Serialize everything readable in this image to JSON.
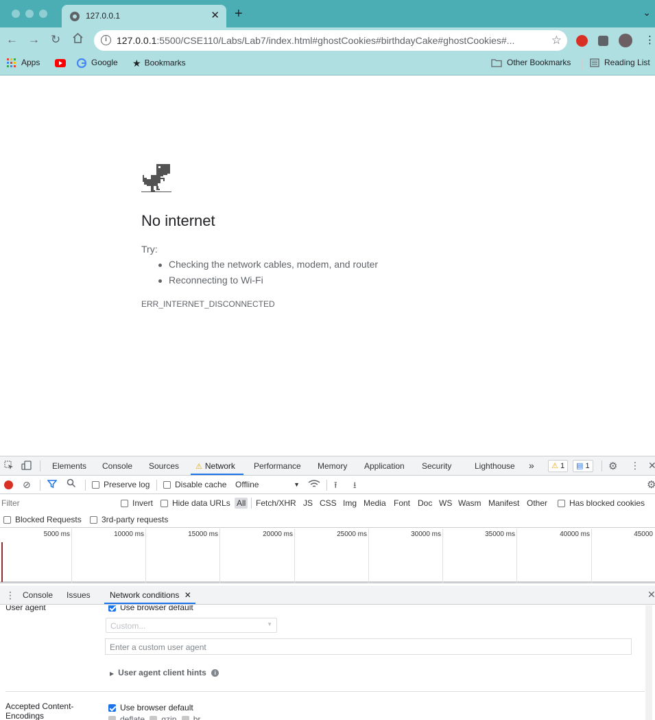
{
  "browser": {
    "tab_title": "127.0.0.1",
    "url_host": "127.0.0.1",
    "url_rest": ":5500/CSE110/Labs/Lab7/index.html#ghostCookies#birthdayCake#ghostCookies#...",
    "bookmarks": [
      {
        "label": "Apps",
        "icon": "apps-grid-icon"
      },
      {
        "label": "",
        "icon": "youtube-icon"
      },
      {
        "label": "Google",
        "icon": "google-icon"
      },
      {
        "label": "Bookmarks",
        "icon": "star-icon"
      }
    ],
    "other_bookmarks": "Other Bookmarks",
    "reading_list": "Reading List"
  },
  "error_page": {
    "title": "No internet",
    "try_label": "Try:",
    "tips": [
      "Checking the network cables, modem, and router",
      "Reconnecting to Wi-Fi"
    ],
    "error_code": "ERR_INTERNET_DISCONNECTED"
  },
  "devtools": {
    "tabs": [
      "Elements",
      "Console",
      "Sources",
      "Network",
      "Performance",
      "Memory",
      "Application",
      "Security",
      "Lighthouse"
    ],
    "active_tab": "Network",
    "more": "»",
    "warnings_count": "1",
    "messages_count": "1",
    "toolbar": {
      "preserve_log": "Preserve log",
      "disable_cache": "Disable cache",
      "throttle": "Offline"
    },
    "filter": {
      "placeholder": "Filter",
      "invert": "Invert",
      "hide_data_urls": "Hide data URLs",
      "types": [
        "All",
        "Fetch/XHR",
        "JS",
        "CSS",
        "Img",
        "Media",
        "Font",
        "Doc",
        "WS",
        "Wasm",
        "Manifest",
        "Other"
      ],
      "has_blocked_cookies": "Has blocked cookies",
      "blocked_requests": "Blocked Requests",
      "third_party": "3rd-party requests"
    },
    "timeline_labels": [
      "5000 ms",
      "10000 ms",
      "15000 ms",
      "20000 ms",
      "25000 ms",
      "30000 ms",
      "35000 ms",
      "40000 ms",
      "45000"
    ],
    "drawer": {
      "tabs": [
        "Console",
        "Issues",
        "Network conditions"
      ],
      "active_tab": "Network conditions",
      "user_agent_label": "User agent",
      "use_browser_default": "Use browser default",
      "custom_select": "Custom...",
      "custom_placeholder": "Enter a custom user agent",
      "client_hints": "User agent client hints",
      "accepted_label_1": "Accepted Content-",
      "accepted_label_2": "Encodings",
      "encodings": [
        "deflate",
        "gzip",
        "br"
      ]
    }
  }
}
